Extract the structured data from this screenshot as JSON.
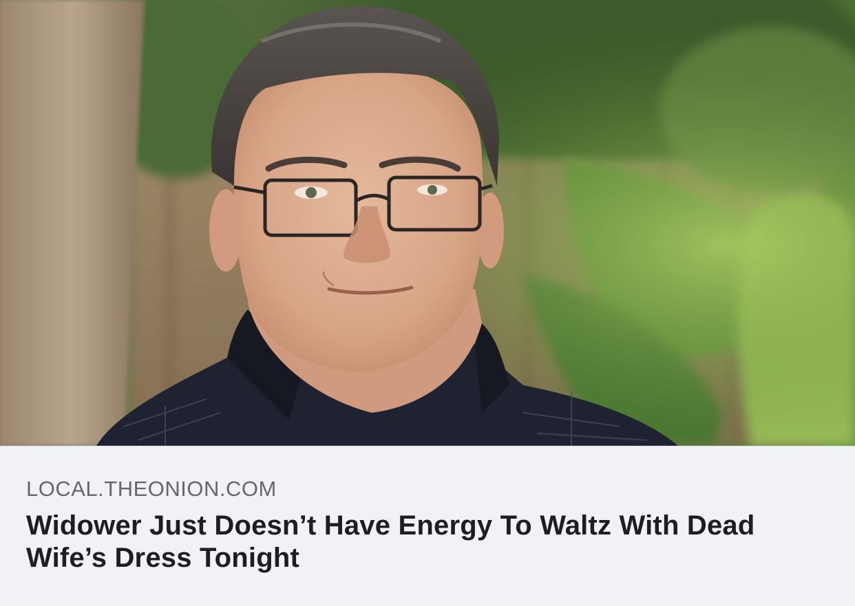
{
  "post": {
    "image": {
      "description": "photo",
      "icon": "photo-portrait"
    },
    "link_preview": {
      "domain": "LOCAL.THEONION.COM",
      "headline": "Widower Just Doesn’t Have Energy To Waltz With Dead Wife’s Dress Tonight"
    }
  },
  "colors": {
    "preview_background": "#f0f2f5",
    "domain_text": "#65676b",
    "headline_text": "#1c1e21"
  }
}
